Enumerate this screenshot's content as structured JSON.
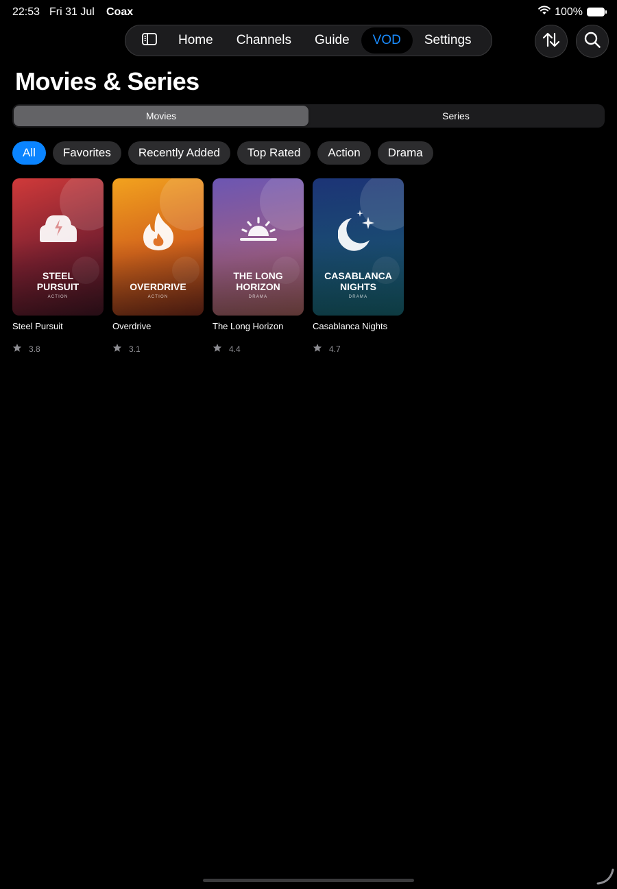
{
  "status_bar": {
    "time": "22:53",
    "date": "Fri 31 Jul",
    "carrier": "Coax",
    "battery": "100%"
  },
  "nav": {
    "sidebar_icon": "sidebar-icon",
    "tabs": [
      {
        "label": "Home",
        "active": false
      },
      {
        "label": "Channels",
        "active": false
      },
      {
        "label": "Guide",
        "active": false
      },
      {
        "label": "VOD",
        "active": true
      },
      {
        "label": "Settings",
        "active": false
      }
    ],
    "sort_icon": "sort-arrows-icon",
    "search_icon": "search-icon"
  },
  "page": {
    "title": "Movies & Series"
  },
  "segments": [
    {
      "label": "Movies",
      "active": true
    },
    {
      "label": "Series",
      "active": false
    }
  ],
  "filters": [
    {
      "label": "All",
      "active": true
    },
    {
      "label": "Favorites",
      "active": false
    },
    {
      "label": "Recently Added",
      "active": false
    },
    {
      "label": "Top Rated",
      "active": false
    },
    {
      "label": "Action",
      "active": false
    },
    {
      "label": "Drama",
      "active": false
    }
  ],
  "movies": [
    {
      "title": "Steel Pursuit",
      "poster_title": "STEEL PURSUIT",
      "genre": "ACTION",
      "rating": "3.8",
      "icon": "car-icon",
      "gradient": [
        "#c83a3a",
        "#4a1620"
      ]
    },
    {
      "title": "Overdrive",
      "poster_title": "OVERDRIVE",
      "genre": "ACTION",
      "rating": "3.1",
      "icon": "flame-icon",
      "gradient": [
        "#f0a020",
        "#6a2a18"
      ]
    },
    {
      "title": "The Long Horizon",
      "poster_title": "THE LONG HORIZON",
      "genre": "DRAMA",
      "rating": "4.4",
      "icon": "sunrise-icon",
      "gradient": [
        "#6a58b0",
        "#8a5060"
      ]
    },
    {
      "title": "Casablanca Nights",
      "poster_title": "CASABLANCA NIGHTS",
      "genre": "DRAMA",
      "rating": "4.7",
      "icon": "moon-stars-icon",
      "gradient": [
        "#1c3a78",
        "#165a66"
      ]
    }
  ],
  "colors": {
    "accent": "#0a84ff",
    "background": "#000000",
    "surface": "#1c1c1e",
    "chip": "#2c2c2e",
    "muted_text": "#8e8e93"
  }
}
